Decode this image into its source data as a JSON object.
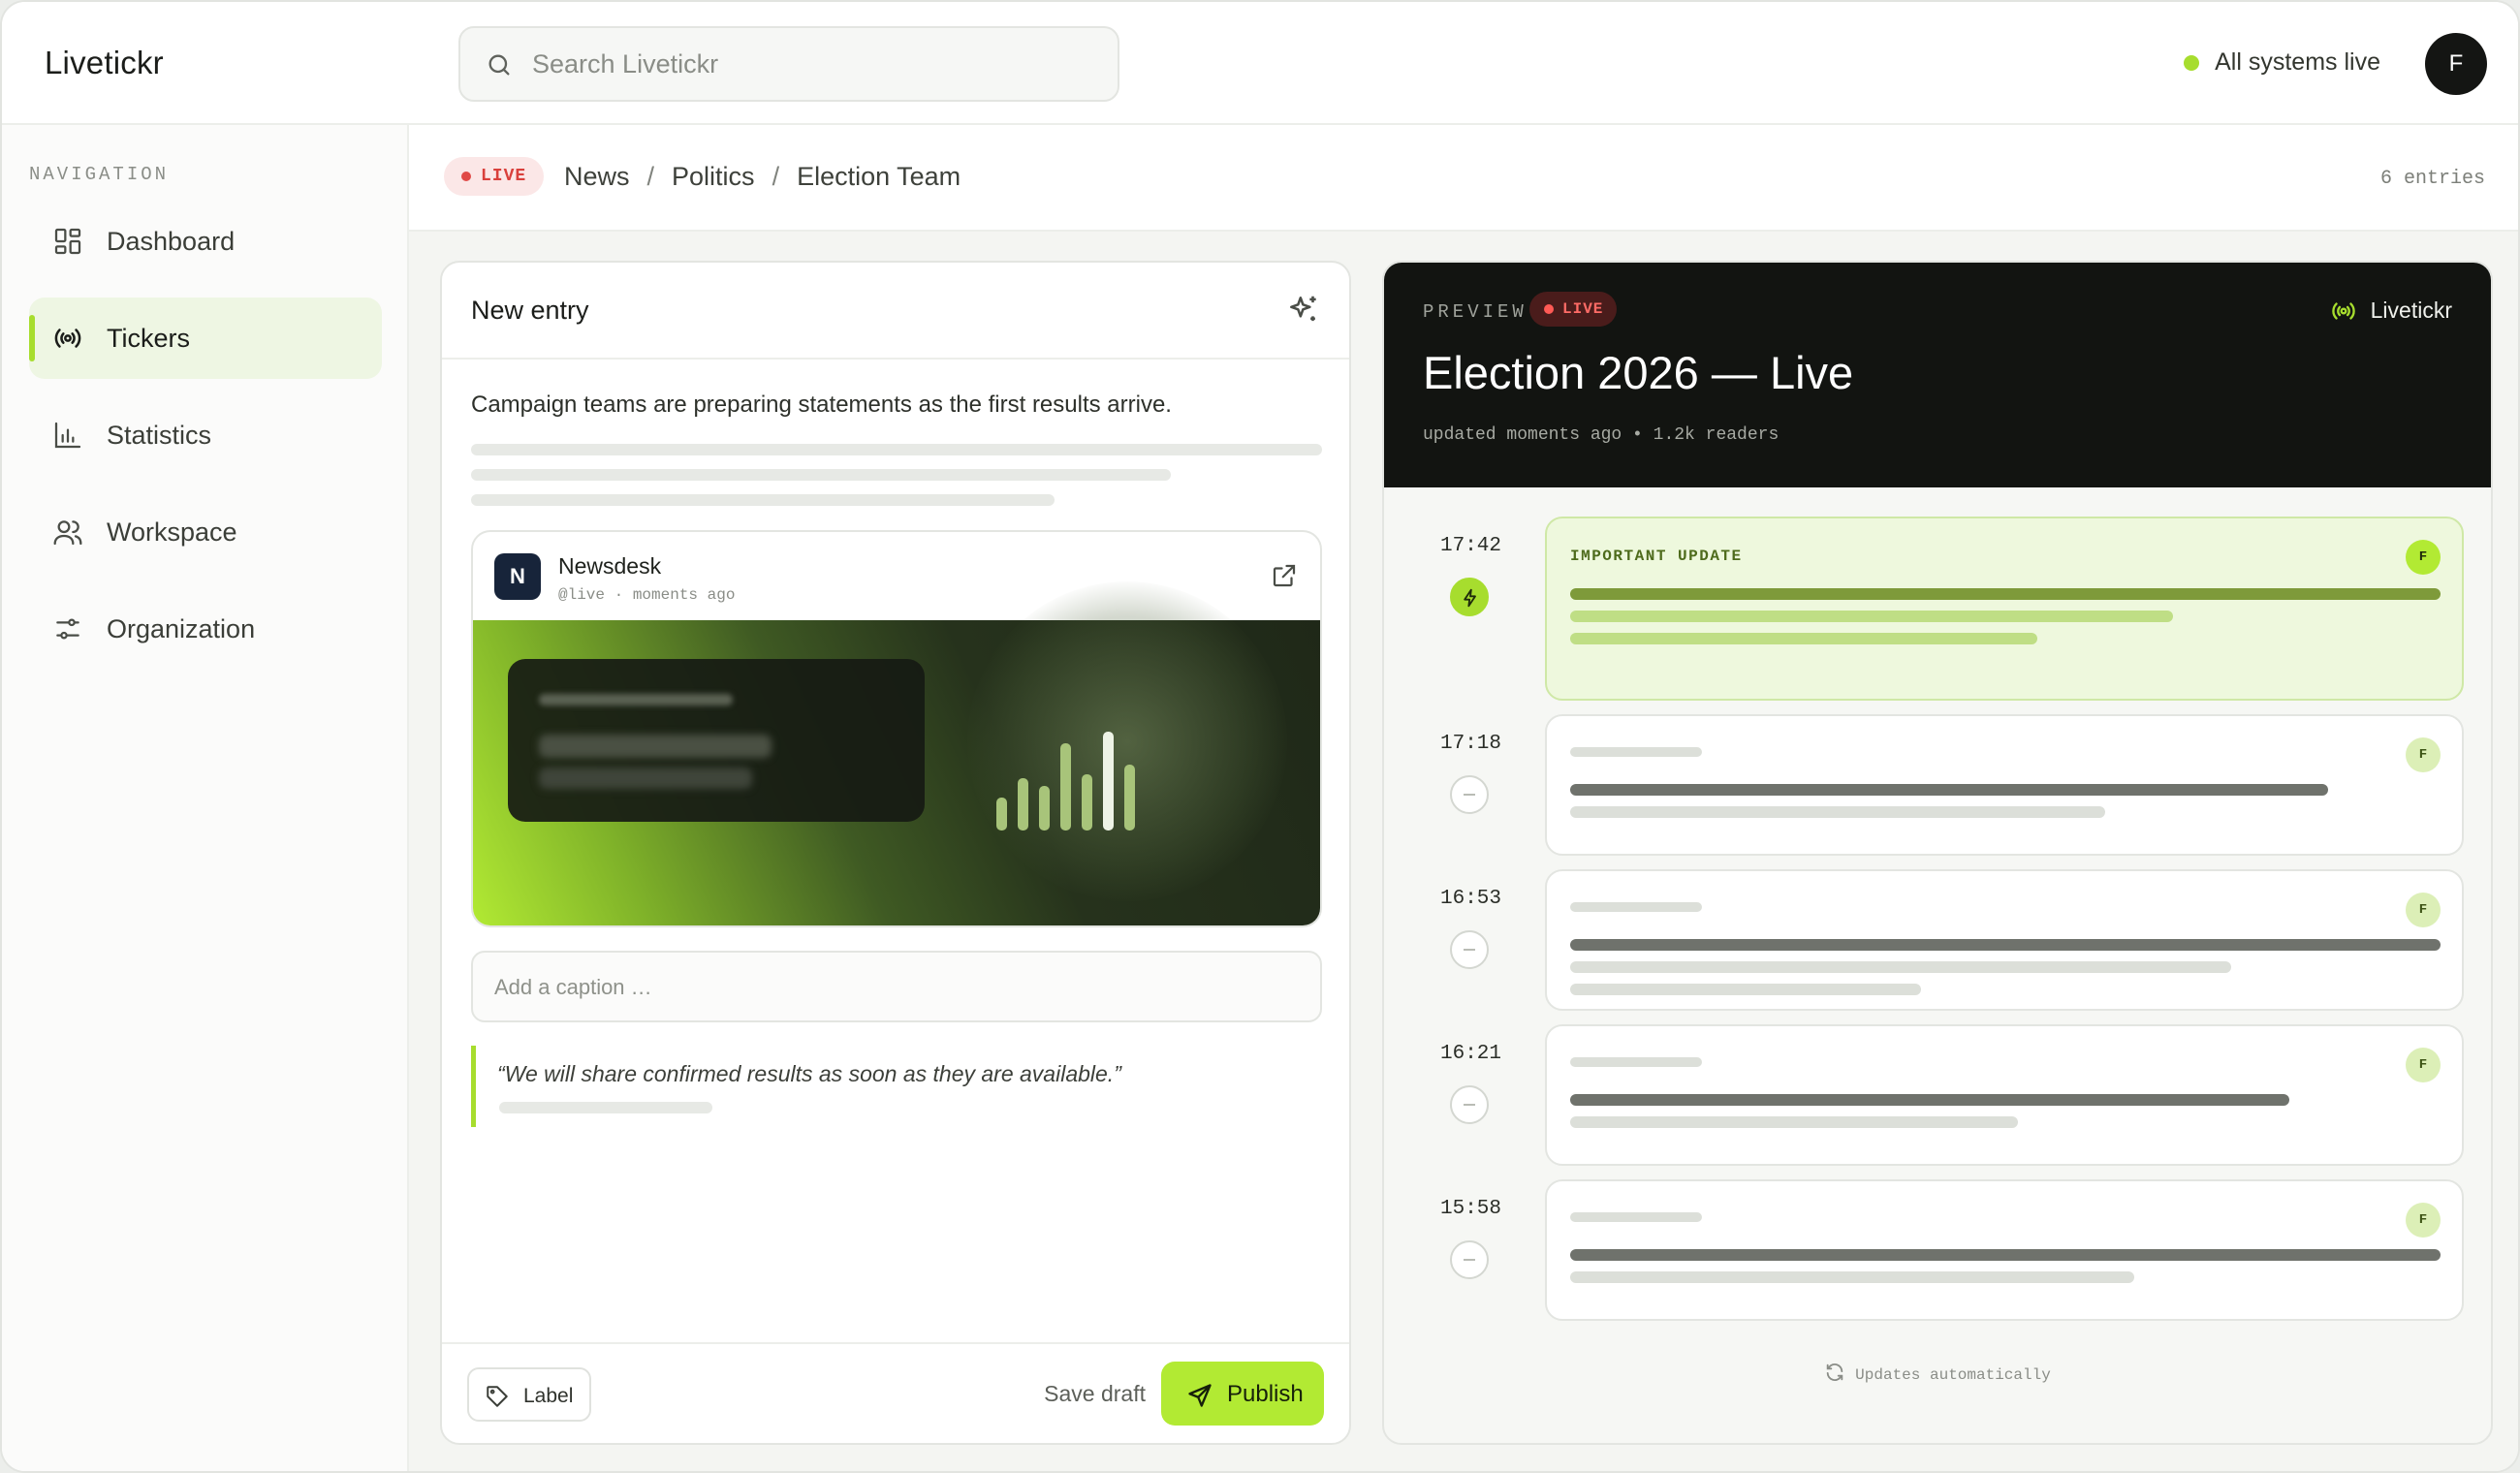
{
  "app": {
    "name": "Livetickr"
  },
  "search": {
    "placeholder": "Search Livetickr"
  },
  "status": {
    "text": "All systems live",
    "color": "#a7dd2e"
  },
  "user": {
    "initial": "F"
  },
  "sidebar": {
    "heading": "NAVIGATION",
    "items": [
      {
        "label": "Dashboard",
        "icon": "dashboard-icon",
        "active": false
      },
      {
        "label": "Tickers",
        "icon": "broadcast-icon",
        "active": true
      },
      {
        "label": "Statistics",
        "icon": "bar-chart-icon",
        "active": false
      },
      {
        "label": "Workspace",
        "icon": "users-icon",
        "active": false
      },
      {
        "label": "Organization",
        "icon": "sliders-icon",
        "active": false
      }
    ]
  },
  "breadcrumb": {
    "live_badge": "LIVE",
    "items": [
      "News",
      "Politics",
      "Election Team"
    ],
    "entries": "6 entries"
  },
  "editor": {
    "title": "New entry",
    "body_text": "Campaign teams are preparing statements as the first results arrive.",
    "embed": {
      "badge": "N",
      "name": "Newsdesk",
      "meta": "@live · moments ago"
    },
    "caption_placeholder": "Add a caption …",
    "quote": "“We will share confirmed results as soon as they are available.”",
    "label_button": "Label",
    "save_draft": "Save draft",
    "publish": "Publish"
  },
  "preview": {
    "label": "PREVIEW",
    "live_badge": "LIVE",
    "brand": "Livetickr",
    "title": "Election 2026 — Live",
    "meta": "updated moments ago • 1.2k readers",
    "entries": [
      {
        "time": "17:42",
        "important": true,
        "tag": "IMPORTANT UPDATE",
        "author": "F"
      },
      {
        "time": "17:18",
        "important": false,
        "author": "F"
      },
      {
        "time": "16:53",
        "important": false,
        "author": "F"
      },
      {
        "time": "16:21",
        "important": false,
        "author": "F"
      },
      {
        "time": "15:58",
        "important": false,
        "author": "F"
      }
    ],
    "auto_update": "Updates automatically"
  },
  "colors": {
    "accent": "#b2ea33",
    "live_red": "#e04a47",
    "dark": "#121411"
  }
}
